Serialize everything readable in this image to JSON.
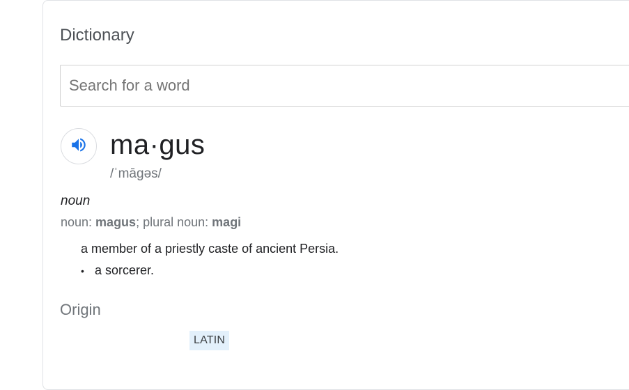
{
  "card": {
    "heading": "Dictionary",
    "search": {
      "placeholder": "Search for a word",
      "value": ""
    },
    "entry": {
      "audio_icon": "speaker-icon",
      "word": "ma·gus",
      "phonetic": "/ˈmāɡəs/",
      "part_of_speech": "noun",
      "forms": {
        "noun_label": "noun: ",
        "noun_value": "magus",
        "sep": "; ",
        "plural_label": "plural noun: ",
        "plural_value": "magi"
      },
      "definitions": [
        "a member of a priestly caste of ancient Persia.",
        "a sorcerer."
      ],
      "bullet": "•"
    },
    "origin": {
      "label": "Origin",
      "language_chip": "LATIN"
    }
  },
  "colors": {
    "accent": "#1a73e8",
    "chip_bg": "#e3f0fb",
    "muted": "#70757a"
  }
}
